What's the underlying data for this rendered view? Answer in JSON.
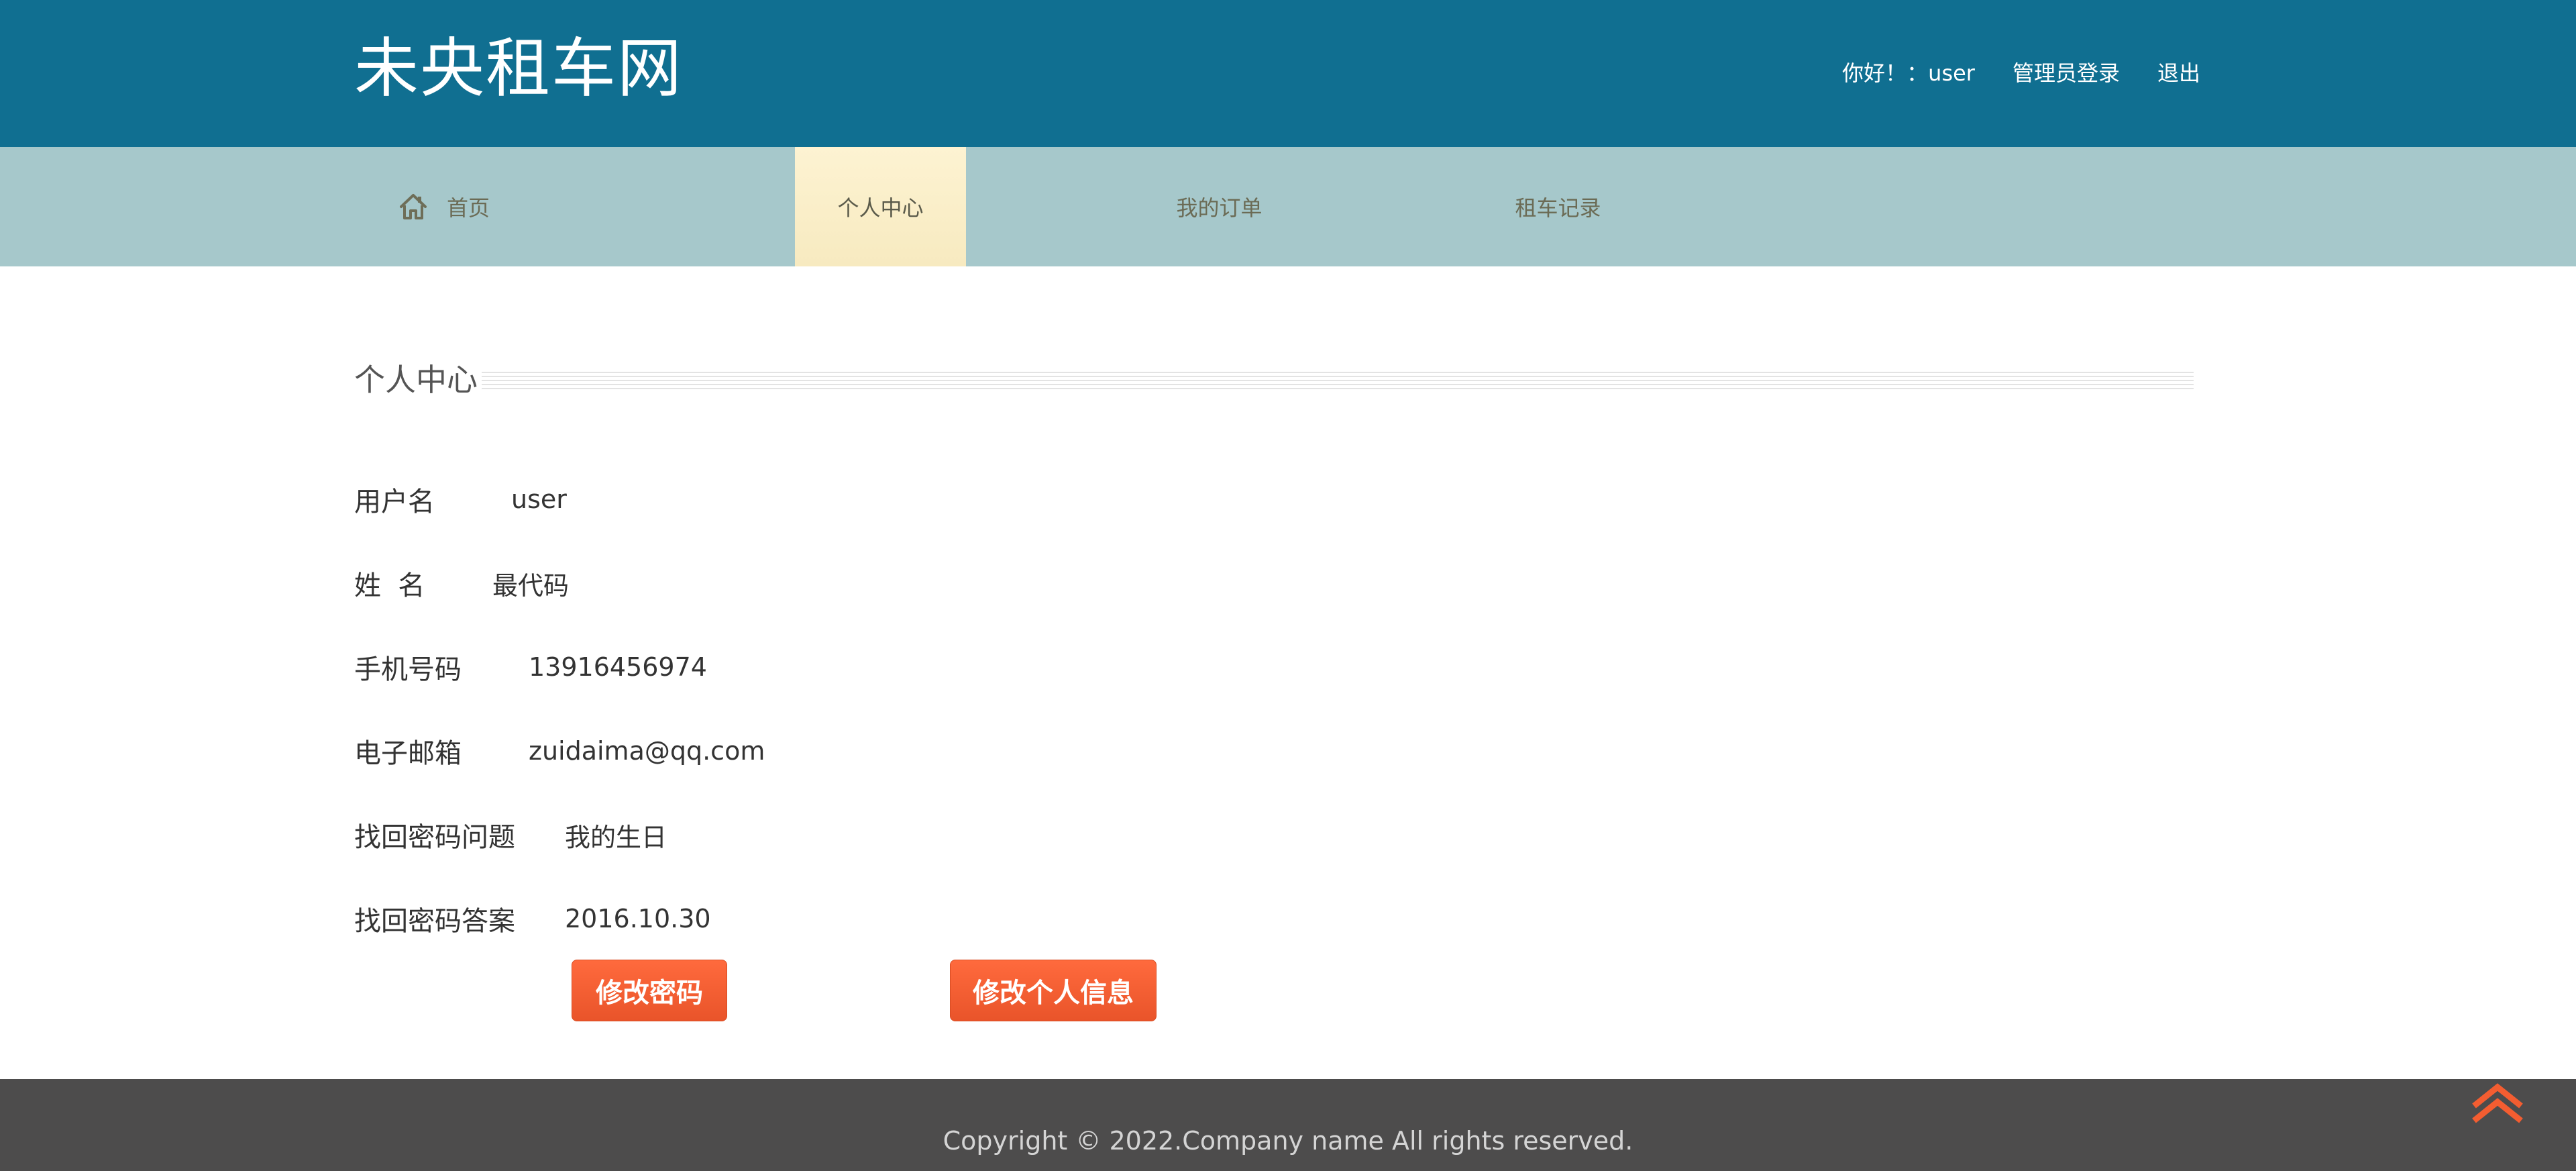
{
  "header": {
    "site_title": "未央租车网",
    "greeting": "你好！：user",
    "admin_login": "管理员登录",
    "logout": "退出"
  },
  "nav": {
    "items": [
      {
        "label": "首页",
        "icon": "home-icon"
      },
      {
        "label": "个人中心",
        "active": true
      },
      {
        "label": "我的订单"
      },
      {
        "label": "租车记录"
      }
    ]
  },
  "profile": {
    "section_title": "个人中心",
    "fields": [
      {
        "label": "用户名",
        "value": "user"
      },
      {
        "label": "姓  名",
        "value": "最代码"
      },
      {
        "label": "手机号码",
        "value": "13916456974"
      },
      {
        "label": "电子邮箱",
        "value": "zuidaima@qq.com"
      },
      {
        "label": "找回密码问题",
        "value": "我的生日"
      },
      {
        "label": "找回密码答案",
        "value": "2016.10.30"
      }
    ],
    "buttons": {
      "change_password": "修改密码",
      "edit_info": "修改个人信息"
    }
  },
  "footer": {
    "copyright": "Copyright © 2022.Company name All rights reserved."
  },
  "colors": {
    "header_bg": "#106f91",
    "nav_bg": "#a6c8cb",
    "nav_active_bg": "#f9eec8",
    "button_bg": "#f35d31",
    "footer_bg": "#4d4c4c",
    "back_top_icon": "#f35d31"
  },
  "icons": {
    "back_to_top": "double-chevron-up-icon"
  }
}
